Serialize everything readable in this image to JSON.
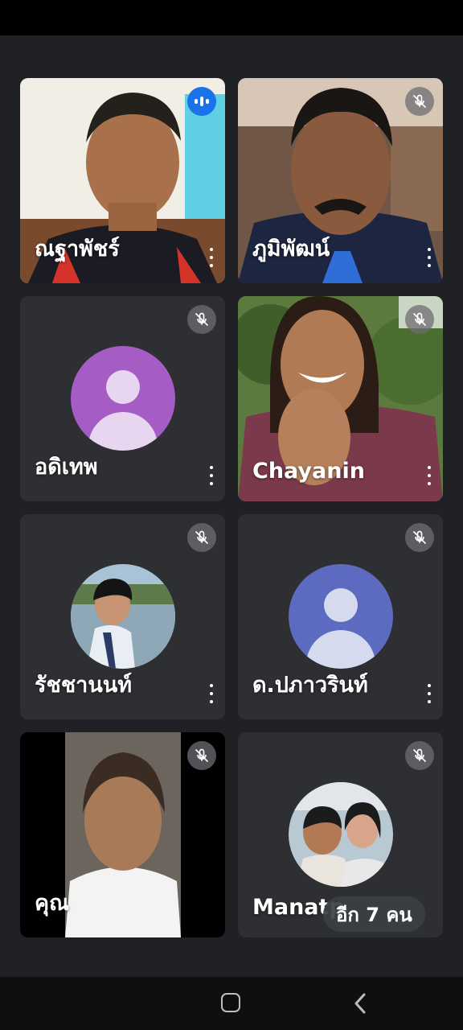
{
  "participants": [
    {
      "name": "ณฐาพัชร์",
      "status": "speaking"
    },
    {
      "name": "ภูมิพัฒน์",
      "status": "muted"
    },
    {
      "name": "อดิเทพ",
      "status": "muted"
    },
    {
      "name": "Chayanin",
      "status": "muted"
    },
    {
      "name": "รัชชานนท์",
      "status": "muted"
    },
    {
      "name": "ด.ปภาวรินท์",
      "status": "muted"
    },
    {
      "name": "คุณ",
      "status": "muted"
    },
    {
      "name": "Manatp",
      "status": "muted"
    }
  ],
  "more_participants_label": "อีก 7 คน",
  "colors": {
    "background": "#202124",
    "tile": "#3c4043",
    "speaking_badge": "#1a73e8",
    "avatar_purple": "#a55cc4",
    "avatar_blue": "#5c6bc0"
  },
  "icons": {
    "mute": "mic-off-icon",
    "speaking": "audio-level-icon",
    "menu": "more-vert-icon"
  }
}
